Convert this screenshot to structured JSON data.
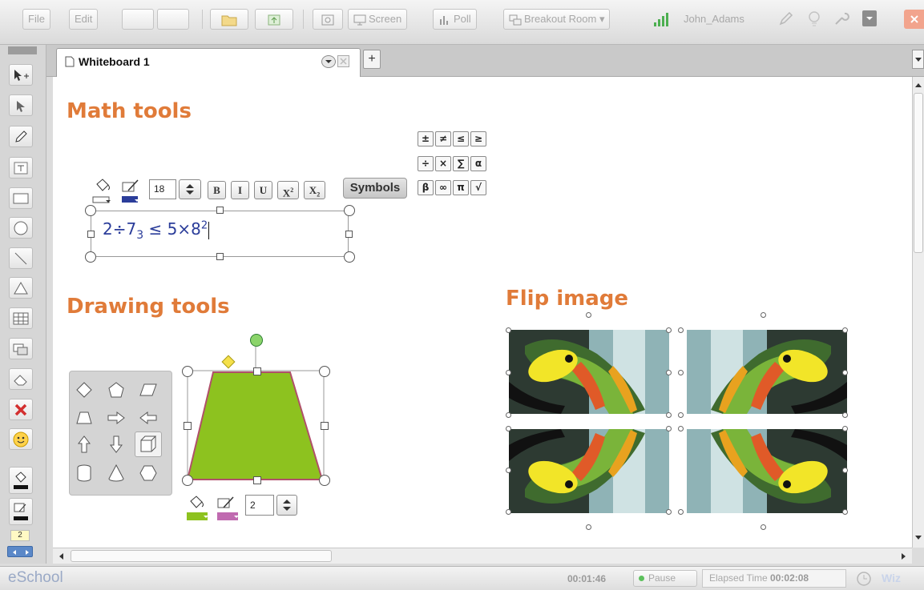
{
  "toolbar": {
    "file_label": "File",
    "edit_label": "Edit",
    "screen_label": "Screen",
    "poll_label": "Poll",
    "breakout_label": "Breakout Room",
    "user_name": "John_Adams"
  },
  "tabs": {
    "active_label": "Whiteboard 1",
    "add_label": "+"
  },
  "math": {
    "heading": "Math tools",
    "font_size": "18",
    "bold_label": "B",
    "italic_label": "I",
    "underline_label": "U",
    "superscript_label": "X",
    "superscript_mark": "2",
    "subscript_label": "X",
    "subscript_mark": "2",
    "symbols_label": "Symbols",
    "symbols": [
      "±",
      "≠",
      "≤",
      "≥",
      "÷",
      "×",
      "∑",
      "α",
      "β",
      "∞",
      "π",
      "√"
    ],
    "expr_main": "2÷7",
    "expr_sub": "3",
    "expr_rest": " ≤ 5×8",
    "expr_sup": "2"
  },
  "drawing": {
    "heading": "Drawing tools",
    "line_width": "2",
    "shape_names": [
      "diamond",
      "pentagon",
      "parallelogram",
      "trapezoid",
      "arrow-right",
      "arrow-left",
      "arrow-up",
      "arrow-down",
      "cube",
      "cylinder",
      "cone",
      "hexagon"
    ],
    "fill_color": "#8dc21f",
    "stroke_color": "#b0506a"
  },
  "flip": {
    "heading": "Flip image"
  },
  "left_toolbar": {
    "line_width_value": "2"
  },
  "status": {
    "brand": "eSchool",
    "timer": "00:01:46",
    "pause_label": "Pause",
    "elapsed_label": "Elapsed Time",
    "elapsed_value": "00:02:08",
    "wiz_label": "Wiz"
  },
  "colors": {
    "accent_heading": "#e07b39",
    "expr_text": "#2b3d9a",
    "brand": "#9aa9c6"
  }
}
